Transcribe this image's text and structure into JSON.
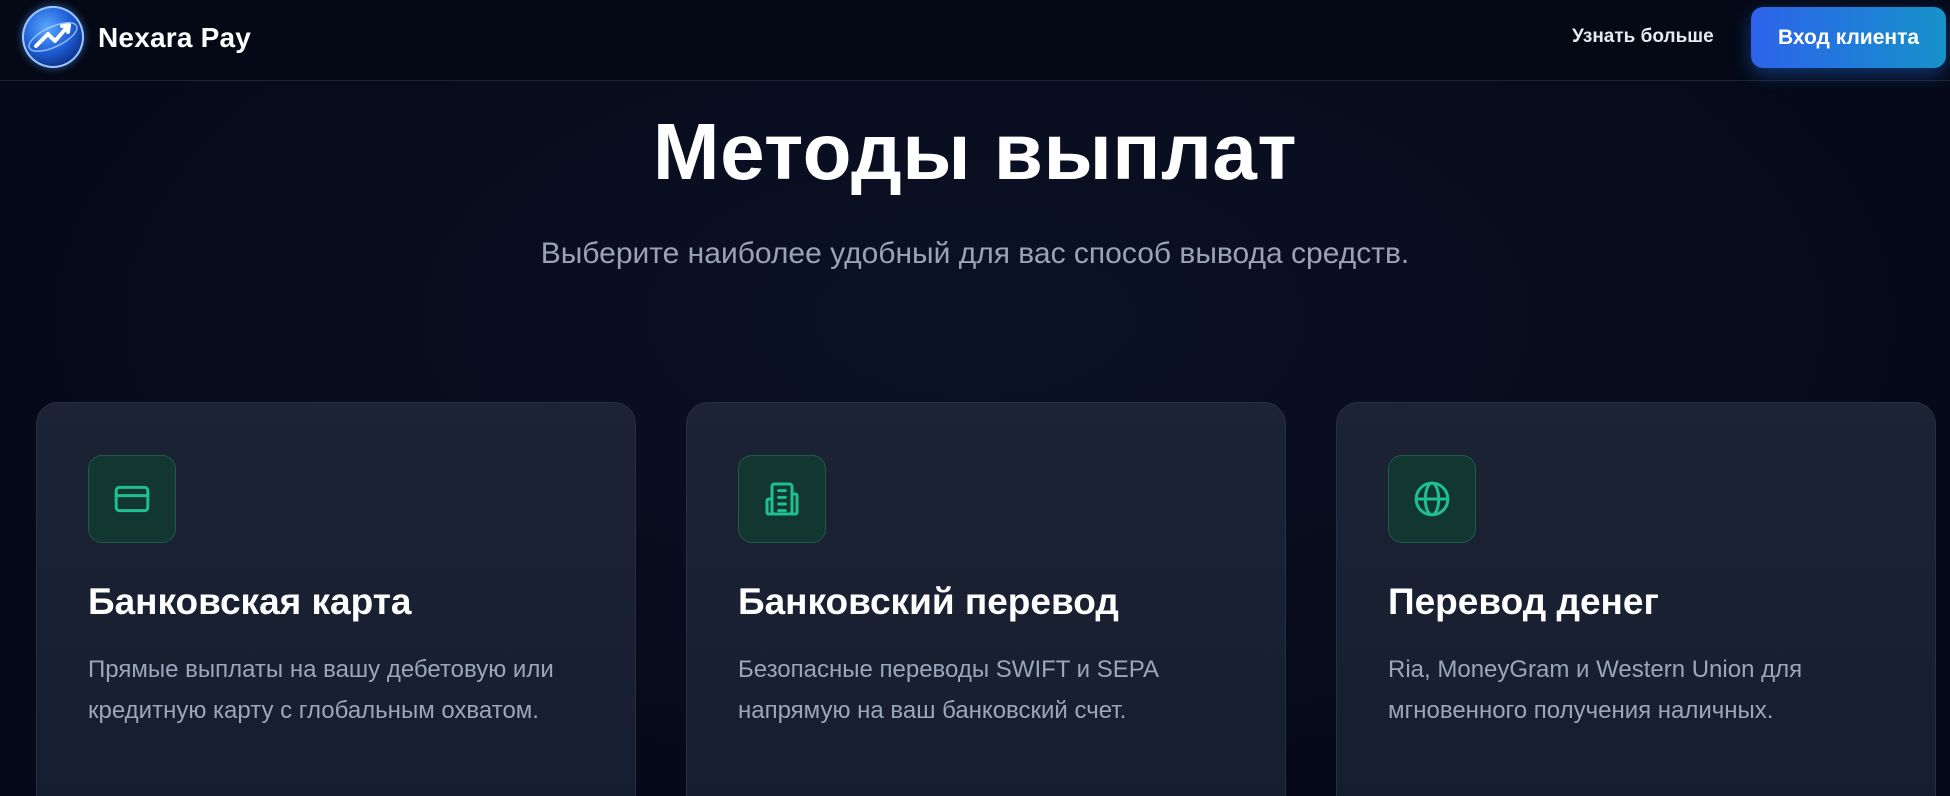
{
  "header": {
    "brand": "Nexara Pay",
    "nav_link": "Узнать больше",
    "login_button": "Вход клиента"
  },
  "hero": {
    "title": "Методы выплат",
    "subtitle": "Выберите наиболее удобный для вас способ вывода средств."
  },
  "methods": [
    {
      "icon": "credit-card-icon",
      "title": "Банковская карта",
      "description": "Прямые выплаты на вашу дебетовую или кредитную карту с глобальным охватом."
    },
    {
      "icon": "building-icon",
      "title": "Банковский перевод",
      "description": "Безопасные переводы SWIFT и SEPA напрямую на ваш банковский счет."
    },
    {
      "icon": "globe-icon",
      "title": "Перевод денег",
      "description": "Ria, MoneyGram и Western Union для мгновенного получения наличных."
    }
  ],
  "colors": {
    "background": "#060a18",
    "card": "#1a2234",
    "accent_green": "#1fc08f",
    "button_blue": "#2d63ea"
  }
}
